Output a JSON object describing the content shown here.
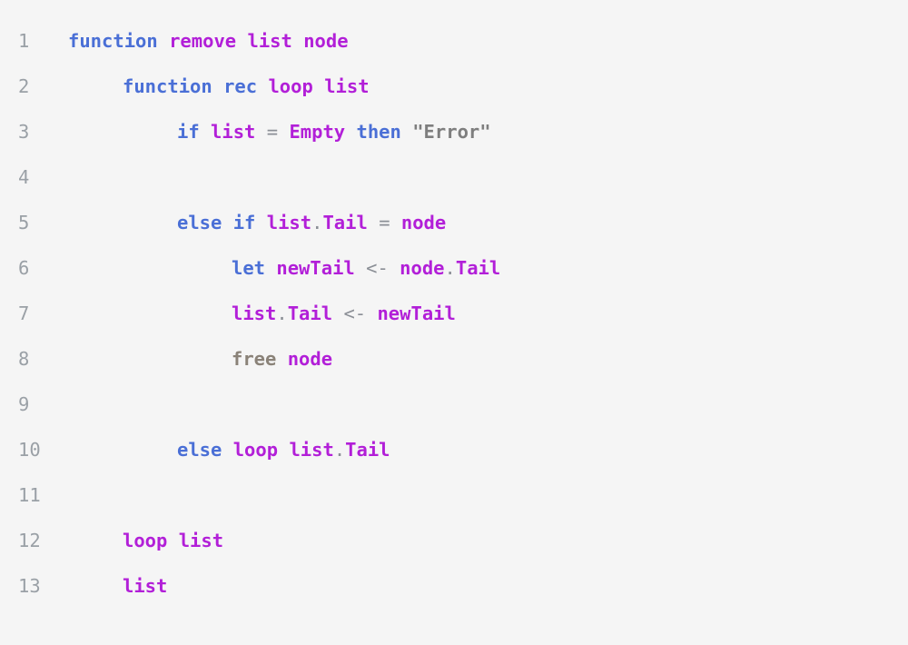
{
  "editor": {
    "lines": [
      {
        "number": "1",
        "indent": 0,
        "tokens": [
          {
            "t": "function",
            "c": "kw"
          },
          {
            "t": " ",
            "c": "ws"
          },
          {
            "t": "remove",
            "c": "id"
          },
          {
            "t": " ",
            "c": "ws"
          },
          {
            "t": "list",
            "c": "id"
          },
          {
            "t": " ",
            "c": "ws"
          },
          {
            "t": "node",
            "c": "id"
          }
        ]
      },
      {
        "number": "2",
        "indent": 1,
        "tokens": [
          {
            "t": "function",
            "c": "kw"
          },
          {
            "t": " ",
            "c": "ws"
          },
          {
            "t": "rec",
            "c": "kw"
          },
          {
            "t": " ",
            "c": "ws"
          },
          {
            "t": "loop",
            "c": "id"
          },
          {
            "t": " ",
            "c": "ws"
          },
          {
            "t": "list",
            "c": "id"
          }
        ]
      },
      {
        "number": "3",
        "indent": 2,
        "tokens": [
          {
            "t": "if",
            "c": "kw"
          },
          {
            "t": " ",
            "c": "ws"
          },
          {
            "t": "list",
            "c": "id"
          },
          {
            "t": " ",
            "c": "ws"
          },
          {
            "t": "=",
            "c": "op"
          },
          {
            "t": " ",
            "c": "ws"
          },
          {
            "t": "Empty",
            "c": "id"
          },
          {
            "t": " ",
            "c": "ws"
          },
          {
            "t": "then",
            "c": "kw"
          },
          {
            "t": " ",
            "c": "ws"
          },
          {
            "t": "\"Error\"",
            "c": "str"
          }
        ]
      },
      {
        "number": "4",
        "indent": 0,
        "tokens": []
      },
      {
        "number": "5",
        "indent": 2,
        "tokens": [
          {
            "t": "else",
            "c": "kw"
          },
          {
            "t": " ",
            "c": "ws"
          },
          {
            "t": "if",
            "c": "kw"
          },
          {
            "t": " ",
            "c": "ws"
          },
          {
            "t": "list",
            "c": "id"
          },
          {
            "t": ".",
            "c": "op"
          },
          {
            "t": "Tail",
            "c": "id"
          },
          {
            "t": " ",
            "c": "ws"
          },
          {
            "t": "=",
            "c": "op"
          },
          {
            "t": " ",
            "c": "ws"
          },
          {
            "t": "node",
            "c": "id"
          }
        ]
      },
      {
        "number": "6",
        "indent": 3,
        "tokens": [
          {
            "t": "let",
            "c": "kw"
          },
          {
            "t": " ",
            "c": "ws"
          },
          {
            "t": "newTail",
            "c": "id"
          },
          {
            "t": " ",
            "c": "ws"
          },
          {
            "t": "<-",
            "c": "op"
          },
          {
            "t": " ",
            "c": "ws"
          },
          {
            "t": "node",
            "c": "id"
          },
          {
            "t": ".",
            "c": "op"
          },
          {
            "t": "Tail",
            "c": "id"
          }
        ]
      },
      {
        "number": "7",
        "indent": 3,
        "tokens": [
          {
            "t": "list",
            "c": "id"
          },
          {
            "t": ".",
            "c": "op"
          },
          {
            "t": "Tail",
            "c": "id"
          },
          {
            "t": " ",
            "c": "ws"
          },
          {
            "t": "<-",
            "c": "op"
          },
          {
            "t": " ",
            "c": "ws"
          },
          {
            "t": "newTail",
            "c": "id"
          }
        ]
      },
      {
        "number": "8",
        "indent": 3,
        "tokens": [
          {
            "t": "free",
            "c": "fn"
          },
          {
            "t": " ",
            "c": "ws"
          },
          {
            "t": "node",
            "c": "id"
          }
        ]
      },
      {
        "number": "9",
        "indent": 0,
        "tokens": []
      },
      {
        "number": "10",
        "indent": 2,
        "tokens": [
          {
            "t": "else",
            "c": "kw"
          },
          {
            "t": " ",
            "c": "ws"
          },
          {
            "t": "loop",
            "c": "id"
          },
          {
            "t": " ",
            "c": "ws"
          },
          {
            "t": "list",
            "c": "id"
          },
          {
            "t": ".",
            "c": "op"
          },
          {
            "t": "Tail",
            "c": "id"
          }
        ]
      },
      {
        "number": "11",
        "indent": 0,
        "tokens": []
      },
      {
        "number": "12",
        "indent": 1,
        "tokens": [
          {
            "t": "loop",
            "c": "id"
          },
          {
            "t": " ",
            "c": "ws"
          },
          {
            "t": "list",
            "c": "id"
          }
        ]
      },
      {
        "number": "13",
        "indent": 1,
        "tokens": [
          {
            "t": "list",
            "c": "id"
          }
        ]
      }
    ]
  },
  "colors": {
    "background": "#f5f5f5",
    "line_number": "#9aa0a6",
    "keyword": "#4a6fd6",
    "identifier": "#b21fd8",
    "operator": "#8b8f96",
    "string": "#7e7e7e",
    "builtin": "#8a8278"
  }
}
